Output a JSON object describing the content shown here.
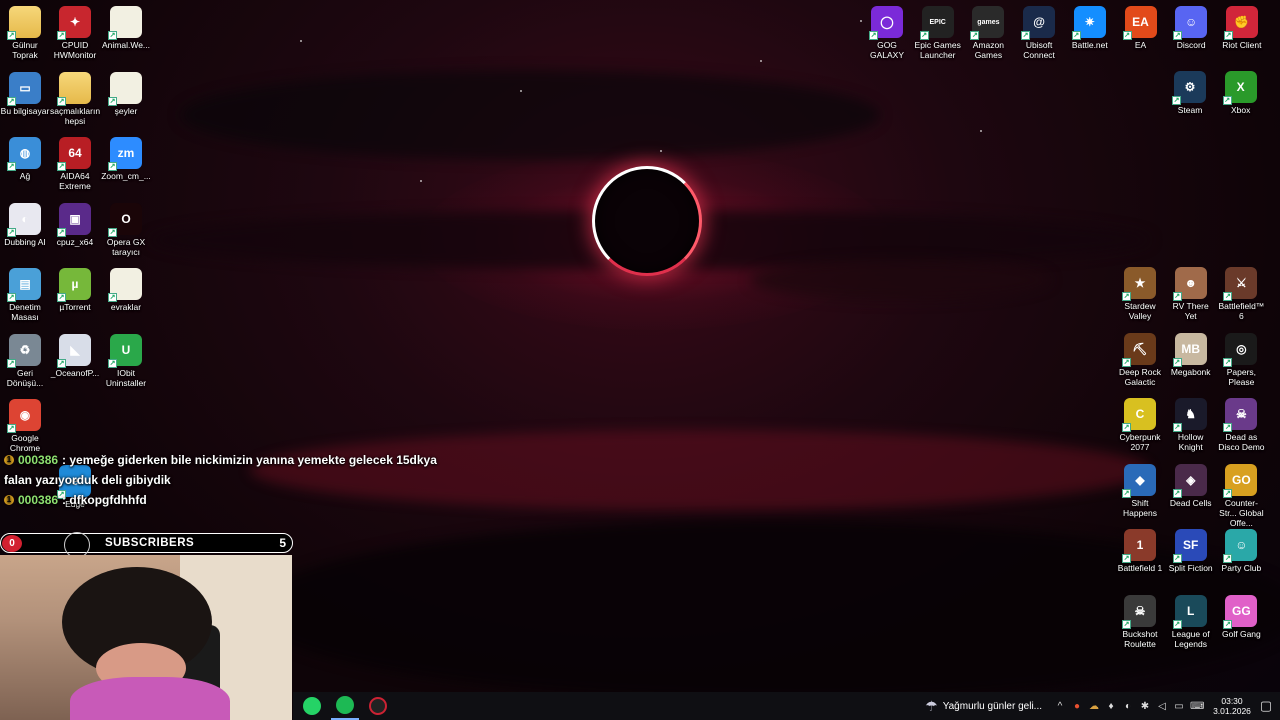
{
  "desktop": {
    "icons_left": [
      {
        "label": "Gülnur Toprak",
        "kind": "folder"
      },
      {
        "label": "CPUID HWMonitor",
        "kind": "app",
        "color": "#c8262e",
        "glyph": "✦"
      },
      {
        "label": "Animal.We...",
        "kind": "doc"
      },
      {
        "label": "Bu bilgisayar",
        "kind": "app",
        "color": "#3a7ec8",
        "glyph": "▭"
      },
      {
        "label": "saçmalıkların hepsi",
        "kind": "folder"
      },
      {
        "label": "şeyler",
        "kind": "doc"
      },
      {
        "label": "Ağ",
        "kind": "app",
        "color": "#3a8ed8",
        "glyph": "◍"
      },
      {
        "label": "AIDA64 Extreme",
        "kind": "app",
        "color": "#b81e24",
        "glyph": "64"
      },
      {
        "label": "Zoom_cm_...",
        "kind": "app",
        "color": "#2d8cff",
        "glyph": "zm"
      },
      {
        "label": "Dubbing AI",
        "kind": "app",
        "color": "#e8e8f0",
        "glyph": "◐"
      },
      {
        "label": "cpuz_x64",
        "kind": "app",
        "color": "#5a2a8a",
        "glyph": "▣"
      },
      {
        "label": "Opera GX tarayıcı",
        "kind": "app",
        "color": "#1a0508",
        "glyph": "O"
      },
      {
        "label": "Denetim Masası",
        "kind": "app",
        "color": "#4aa0d8",
        "glyph": "▤"
      },
      {
        "label": "µTorrent",
        "kind": "app",
        "color": "#76b83a",
        "glyph": "µ"
      },
      {
        "label": "evraklar",
        "kind": "doc"
      },
      {
        "label": "Geri Dönüşü...",
        "kind": "app",
        "color": "#7a8894",
        "glyph": "♻"
      },
      {
        "label": "_OceanofP...",
        "kind": "app",
        "color": "#d8dde8",
        "glyph": "◣"
      },
      {
        "label": "IObit Uninstaller",
        "kind": "app",
        "color": "#2aa84a",
        "glyph": "U"
      },
      {
        "label": "Google Chrome",
        "kind": "app",
        "color": "#dd4433",
        "glyph": "◉"
      },
      {
        "label": "Edge",
        "kind": "app",
        "color": "#1e8ad8",
        "glyph": "e"
      }
    ],
    "icons_right_top": [
      {
        "label": "GOG GALAXY",
        "color": "#7b2ad8",
        "glyph": "◯"
      },
      {
        "label": "Epic Games Launcher",
        "color": "#222",
        "glyph": "EPIC"
      },
      {
        "label": "Amazon Games",
        "color": "#2a2a2a",
        "glyph": "games"
      },
      {
        "label": "Ubisoft Connect",
        "color": "#1a2a4a",
        "glyph": "@"
      },
      {
        "label": "Battle.net",
        "color": "#148eff",
        "glyph": "✷"
      },
      {
        "label": "EA",
        "color": "#e24a1a",
        "glyph": "EA"
      },
      {
        "label": "Discord",
        "color": "#5865f2",
        "glyph": "☺"
      },
      {
        "label": "Riot Client",
        "color": "#d1263a",
        "glyph": "✊"
      },
      {
        "label": "Steam",
        "color": "#1b3a5a",
        "glyph": "⚙"
      },
      {
        "label": "Xbox",
        "color": "#2a9a2a",
        "glyph": "X"
      }
    ],
    "icons_right_games": [
      {
        "label": "Stardew Valley",
        "color": "#8a5a2a",
        "glyph": "★"
      },
      {
        "label": "RV There Yet",
        "color": "#a06a4a",
        "glyph": "☻"
      },
      {
        "label": "Battlefield™ 6",
        "color": "#6a3a2a",
        "glyph": "⚔"
      },
      {
        "label": "Deep Rock Galactic",
        "color": "#6a3a1a",
        "glyph": "⛏"
      },
      {
        "label": "Megabonk",
        "color": "#c8b8a0",
        "glyph": "MB"
      },
      {
        "label": "Papers, Please",
        "color": "#1a1a1a",
        "glyph": "◎"
      },
      {
        "label": "Cyberpunk 2077",
        "color": "#d8c020",
        "glyph": "C"
      },
      {
        "label": "Hollow Knight",
        "color": "#1a1a2a",
        "glyph": "♞"
      },
      {
        "label": "Dead as Disco Demo",
        "color": "#6a3a8a",
        "glyph": "☠"
      },
      {
        "label": "Shift Happens",
        "color": "#2a6ab8",
        "glyph": "◆"
      },
      {
        "label": "Dead Cells",
        "color": "#4a2a4a",
        "glyph": "◈"
      },
      {
        "label": "Counter-Str... Global Offe...",
        "color": "#d8a020",
        "glyph": "GO"
      },
      {
        "label": "Battlefield 1",
        "color": "#8a3a2a",
        "glyph": "1"
      },
      {
        "label": "Split Fiction",
        "color": "#2a4ab8",
        "glyph": "SF"
      },
      {
        "label": "Party Club",
        "color": "#2aa8a8",
        "glyph": "☺"
      },
      {
        "label": "Buckshot Roulette",
        "color": "#3a3a3a",
        "glyph": "☠"
      },
      {
        "label": "League of Legends",
        "color": "#1a4a5a",
        "glyph": "L"
      },
      {
        "label": "Golf Gang",
        "color": "#e060c8",
        "glyph": "GG"
      }
    ]
  },
  "chat": {
    "messages": [
      {
        "badge": "1",
        "user": "000386",
        "text": ": yemeğe giderken bile nickimizin yanına yemekte gelecek 15dkya"
      },
      {
        "badge": "",
        "user": "",
        "text": "falan yazıyorduk deli gibiydik"
      },
      {
        "badge": "1",
        "user": "000386",
        "text": ": dfkopgfdhhfd"
      }
    ]
  },
  "overlay": {
    "zero_badge": "0",
    "subscribers_label": "SUBSCRIBERS",
    "subscribers_count": "5"
  },
  "taskbar": {
    "apps": [
      {
        "name": "whatsapp",
        "color": "#25d366",
        "active": false
      },
      {
        "name": "spotify",
        "color": "#1db954",
        "active": true
      },
      {
        "name": "obs",
        "color": "#cc2233",
        "active": false
      }
    ],
    "weather_text": "Yağmurlu günler geli...",
    "time": "03:30",
    "date": "3.01.2026"
  }
}
